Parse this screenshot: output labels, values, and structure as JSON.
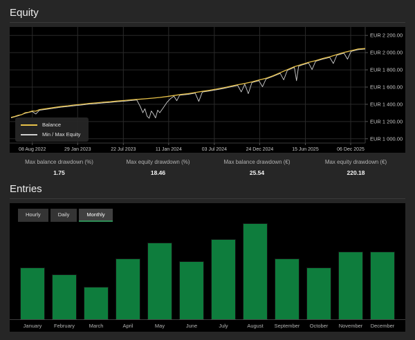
{
  "equity_section": {
    "title": "Equity",
    "stats": [
      {
        "label": "Max balance drawdown (%)",
        "value": "1.75"
      },
      {
        "label": "Max equity drawdown (%)",
        "value": "18.46"
      },
      {
        "label": "Max balance drawdown (€)",
        "value": "25.54"
      },
      {
        "label": "Max equity drawdown (€)",
        "value": "220.18"
      }
    ]
  },
  "entries_section": {
    "title": "Entries",
    "tabs": [
      {
        "label": "Hourly",
        "active": false
      },
      {
        "label": "Daily",
        "active": false
      },
      {
        "label": "Monthly",
        "active": true
      }
    ]
  },
  "colors": {
    "balance_line": "#e8c24a",
    "equity_line": "#d0d0d0",
    "bar_green": "#0e7d3d",
    "grid": "#2a2a2a",
    "axis_text": "#c9c9c9",
    "axis_line": "#3a3a3a"
  },
  "chart_data": [
    {
      "type": "line",
      "title": "Equity",
      "ylabel": "EUR",
      "ylim": [
        950,
        2250
      ],
      "grid": true,
      "legend_position": "bottom-left",
      "y_ticks": [
        {
          "value": 2200,
          "label": "EUR 2 200.00"
        },
        {
          "value": 2000,
          "label": "EUR 2 000.00"
        },
        {
          "value": 1800,
          "label": "EUR 1 800.00"
        },
        {
          "value": 1600,
          "label": "EUR 1 600.00"
        },
        {
          "value": 1400,
          "label": "EUR 1 400.00"
        },
        {
          "value": 1200,
          "label": "EUR 1 200.00"
        },
        {
          "value": 1000,
          "label": "EUR 1 000.00"
        }
      ],
      "x_ticks": [
        {
          "f": 0.06,
          "label": "08 Aug 2022"
        },
        {
          "f": 0.188,
          "label": "29 Jan 2023"
        },
        {
          "f": 0.317,
          "label": "22 Jul 2023"
        },
        {
          "f": 0.445,
          "label": "11 Jan 2024"
        },
        {
          "f": 0.574,
          "label": "03 Jul 2024"
        },
        {
          "f": 0.702,
          "label": "24 Dec 2024"
        },
        {
          "f": 0.831,
          "label": "15 Jun 2025"
        },
        {
          "f": 0.959,
          "label": "06 Dec 2025"
        }
      ],
      "series": [
        {
          "name": "Balance",
          "color": "#e8c24a",
          "points": [
            [
              0,
              1248
            ],
            [
              0.01,
              1258
            ],
            [
              0.02,
              1272
            ],
            [
              0.03,
              1280
            ],
            [
              0.04,
              1302
            ],
            [
              0.05,
              1308
            ],
            [
              0.06,
              1322
            ],
            [
              0.07,
              1320
            ],
            [
              0.08,
              1338
            ],
            [
              0.1,
              1350
            ],
            [
              0.12,
              1362
            ],
            [
              0.14,
              1374
            ],
            [
              0.16,
              1382
            ],
            [
              0.18,
              1392
            ],
            [
              0.2,
              1400
            ],
            [
              0.22,
              1410
            ],
            [
              0.24,
              1416
            ],
            [
              0.26,
              1424
            ],
            [
              0.28,
              1430
            ],
            [
              0.3,
              1438
            ],
            [
              0.32,
              1444
            ],
            [
              0.34,
              1452
            ],
            [
              0.36,
              1458
            ],
            [
              0.38,
              1464
            ],
            [
              0.4,
              1472
            ],
            [
              0.42,
              1480
            ],
            [
              0.44,
              1490
            ],
            [
              0.46,
              1502
            ],
            [
              0.48,
              1514
            ],
            [
              0.5,
              1524
            ],
            [
              0.52,
              1537
            ],
            [
              0.54,
              1550
            ],
            [
              0.56,
              1562
            ],
            [
              0.58,
              1577
            ],
            [
              0.6,
              1592
            ],
            [
              0.62,
              1610
            ],
            [
              0.64,
              1627
            ],
            [
              0.66,
              1642
            ],
            [
              0.68,
              1660
            ],
            [
              0.7,
              1682
            ],
            [
              0.72,
              1702
            ],
            [
              0.74,
              1732
            ],
            [
              0.76,
              1767
            ],
            [
              0.78,
              1802
            ],
            [
              0.8,
              1837
            ],
            [
              0.82,
              1862
            ],
            [
              0.84,
              1887
            ],
            [
              0.86,
              1907
            ],
            [
              0.88,
              1932
            ],
            [
              0.9,
              1952
            ],
            [
              0.92,
              1977
            ],
            [
              0.94,
              2002
            ],
            [
              0.96,
              2022
            ],
            [
              0.98,
              2042
            ],
            [
              1,
              2048
            ]
          ]
        },
        {
          "name": "Min / Max Equity",
          "color": "#d0d0d0",
          "points": [
            [
              0,
              1242
            ],
            [
              0.02,
              1265
            ],
            [
              0.04,
              1295
            ],
            [
              0.06,
              1315
            ],
            [
              0.07,
              1288
            ],
            [
              0.08,
              1330
            ],
            [
              0.1,
              1342
            ],
            [
              0.12,
              1354
            ],
            [
              0.14,
              1366
            ],
            [
              0.16,
              1374
            ],
            [
              0.18,
              1384
            ],
            [
              0.2,
              1392
            ],
            [
              0.22,
              1402
            ],
            [
              0.24,
              1408
            ],
            [
              0.26,
              1416
            ],
            [
              0.28,
              1422
            ],
            [
              0.3,
              1430
            ],
            [
              0.32,
              1436
            ],
            [
              0.34,
              1444
            ],
            [
              0.355,
              1450
            ],
            [
              0.365,
              1372
            ],
            [
              0.372,
              1302
            ],
            [
              0.378,
              1348
            ],
            [
              0.384,
              1262
            ],
            [
              0.39,
              1238
            ],
            [
              0.396,
              1322
            ],
            [
              0.402,
              1288
            ],
            [
              0.408,
              1242
            ],
            [
              0.414,
              1332
            ],
            [
              0.42,
              1302
            ],
            [
              0.43,
              1362
            ],
            [
              0.44,
              1422
            ],
            [
              0.45,
              1465
            ],
            [
              0.46,
              1494
            ],
            [
              0.468,
              1442
            ],
            [
              0.476,
              1505
            ],
            [
              0.5,
              1516
            ],
            [
              0.52,
              1529
            ],
            [
              0.53,
              1434
            ],
            [
              0.54,
              1542
            ],
            [
              0.56,
              1554
            ],
            [
              0.58,
              1569
            ],
            [
              0.6,
              1584
            ],
            [
              0.62,
              1602
            ],
            [
              0.64,
              1619
            ],
            [
              0.65,
              1544
            ],
            [
              0.66,
              1634
            ],
            [
              0.67,
              1524
            ],
            [
              0.68,
              1652
            ],
            [
              0.7,
              1674
            ],
            [
              0.71,
              1604
            ],
            [
              0.72,
              1694
            ],
            [
              0.74,
              1724
            ],
            [
              0.76,
              1759
            ],
            [
              0.77,
              1684
            ],
            [
              0.78,
              1794
            ],
            [
              0.8,
              1829
            ],
            [
              0.806,
              1674
            ],
            [
              0.812,
              1841
            ],
            [
              0.82,
              1854
            ],
            [
              0.84,
              1879
            ],
            [
              0.85,
              1804
            ],
            [
              0.86,
              1899
            ],
            [
              0.88,
              1924
            ],
            [
              0.9,
              1944
            ],
            [
              0.91,
              1874
            ],
            [
              0.92,
              1969
            ],
            [
              0.94,
              1994
            ],
            [
              0.95,
              1924
            ],
            [
              0.96,
              2014
            ],
            [
              0.98,
              2034
            ],
            [
              1,
              2042
            ]
          ]
        }
      ]
    },
    {
      "type": "bar",
      "title": "Entries (Monthly)",
      "categories": [
        "January",
        "February",
        "March",
        "April",
        "May",
        "June",
        "July",
        "August",
        "September",
        "October",
        "November",
        "December"
      ],
      "values": [
        16,
        14,
        10,
        19,
        24,
        18,
        25,
        30,
        19,
        16,
        21,
        21
      ],
      "color": "#0e7d3d",
      "ylim": [
        0,
        30
      ],
      "grid": false,
      "legend_position": "none"
    }
  ]
}
